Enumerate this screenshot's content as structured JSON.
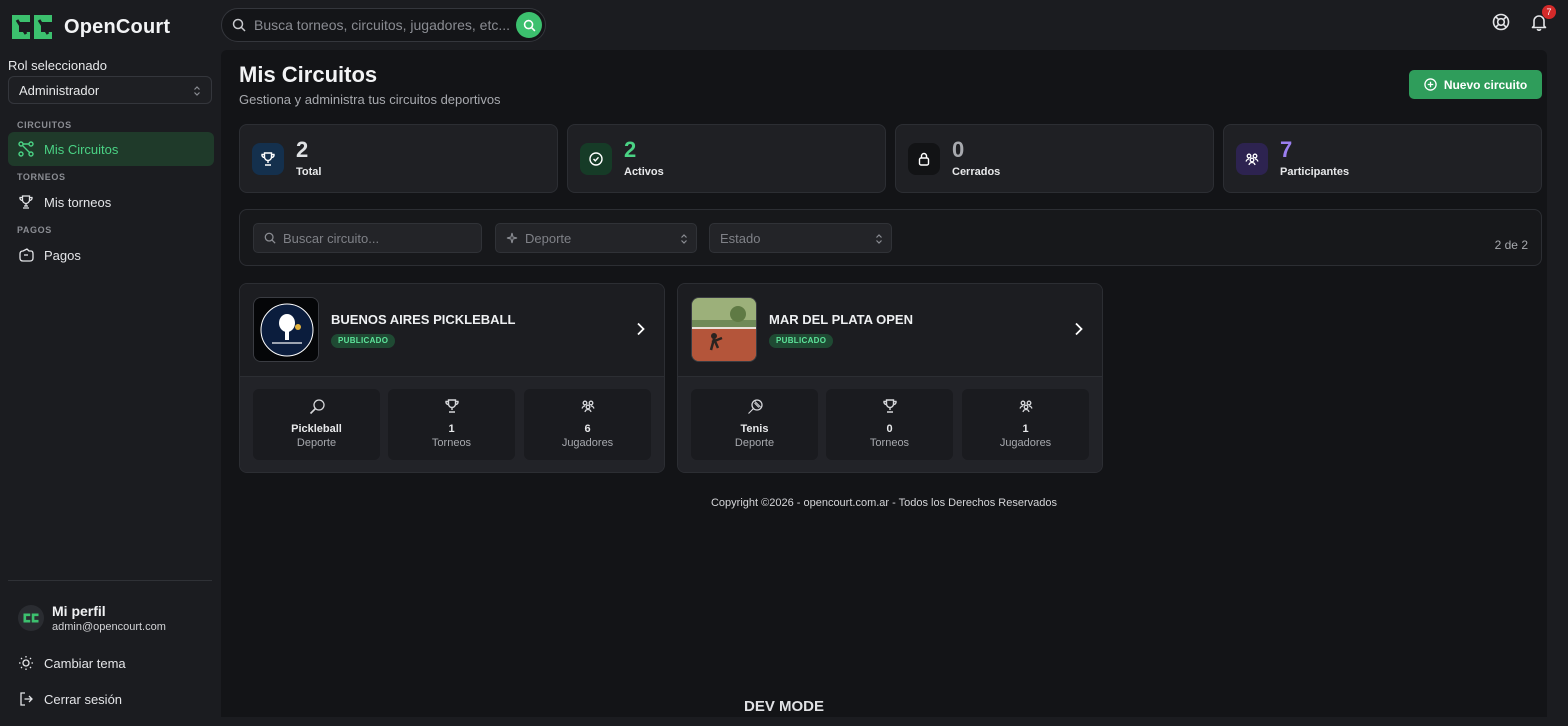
{
  "app": {
    "name": "OpenCourt"
  },
  "search": {
    "placeholder": "Busca torneos, circuitos, jugadores, etc..."
  },
  "notifications": {
    "count": "7"
  },
  "sidebar": {
    "role_label": "Rol seleccionado",
    "role_value": "Administrador",
    "sections": [
      {
        "title": "CIRCUITOS",
        "item": "Mis Circuitos"
      },
      {
        "title": "TORNEOS",
        "item": "Mis torneos"
      },
      {
        "title": "PAGOS",
        "item": "Pagos"
      }
    ],
    "profile": {
      "name": "Mi perfil",
      "email": "admin@opencourt.com"
    },
    "theme": "Cambiar tema",
    "logout": "Cerrar sesión"
  },
  "main": {
    "title": "Mis Circuitos",
    "subtitle": "Gestiona y administra tus circuitos deportivos",
    "new_button": "Nuevo circuito",
    "stats": [
      {
        "value": "2",
        "label": "Total",
        "color": "#dfe1e4",
        "icon": "trophy-icon"
      },
      {
        "value": "2",
        "label": "Activos",
        "color": "#4ad284",
        "icon": "check-circle-icon"
      },
      {
        "value": "0",
        "label": "Cerrados",
        "color": "#a7a9ae",
        "icon": "lock-icon"
      },
      {
        "value": "7",
        "label": "Participantes",
        "color": "#9b7ff0",
        "icon": "users-icon"
      }
    ],
    "filters": {
      "search_placeholder": "Buscar circuito...",
      "sport_placeholder": "Deporte",
      "state_placeholder": "Estado",
      "count": "2 de 2"
    },
    "cards": [
      {
        "title": "BUENOS AIRES PICKLEBALL",
        "status": "PUBLICADO",
        "sport": "Pickleball",
        "sport_label": "Deporte",
        "tournaments": "1",
        "tournaments_label": "Torneos",
        "players": "6",
        "players_label": "Jugadores"
      },
      {
        "title": "MAR DEL PLATA OPEN",
        "status": "PUBLICADO",
        "sport": "Tenis",
        "sport_label": "Deporte",
        "tournaments": "0",
        "tournaments_label": "Torneos",
        "players": "1",
        "players_label": "Jugadores"
      }
    ],
    "copyright": "Copyright ©2026 - opencourt.com.ar - Todos los Derechos Reservados"
  },
  "footer": {
    "dev": "DEV MODE"
  }
}
